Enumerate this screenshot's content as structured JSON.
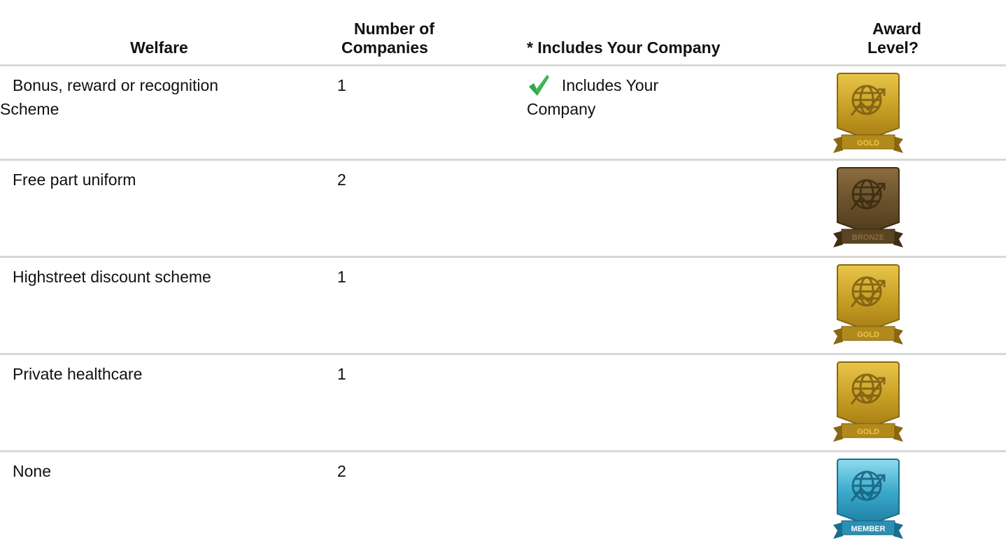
{
  "headers": {
    "welfare": "Welfare",
    "num_line1": "Number of",
    "num_line2": "Companies",
    "includes": "* Includes Your Company",
    "award_line1": "Award",
    "award_line2": "Level?"
  },
  "rows": [
    {
      "welfare_line1": "Bonus, reward or recognition",
      "welfare_line2": "Scheme",
      "count": "1",
      "includes_line1": "Includes Your",
      "includes_line2": "Company",
      "badge": "GOLD"
    },
    {
      "welfare_line1": "Free part uniform",
      "count": "2",
      "badge": "BRONZE"
    },
    {
      "welfare_line1": "Highstreet discount scheme",
      "count": "1",
      "badge": "GOLD"
    },
    {
      "welfare_line1": "Private healthcare",
      "count": "1",
      "badge": "GOLD"
    },
    {
      "welfare_line1": "None",
      "count": "2",
      "badge": "MEMBER"
    }
  ],
  "icons": {
    "check": "check-icon",
    "badge": "globe-arrow-badge-icon"
  },
  "colors": {
    "gold": "#c9a227",
    "bronze": "#6e5530",
    "member": "#2f9fc0",
    "check": "#2ea84a",
    "divider": "#d8d8d8"
  }
}
